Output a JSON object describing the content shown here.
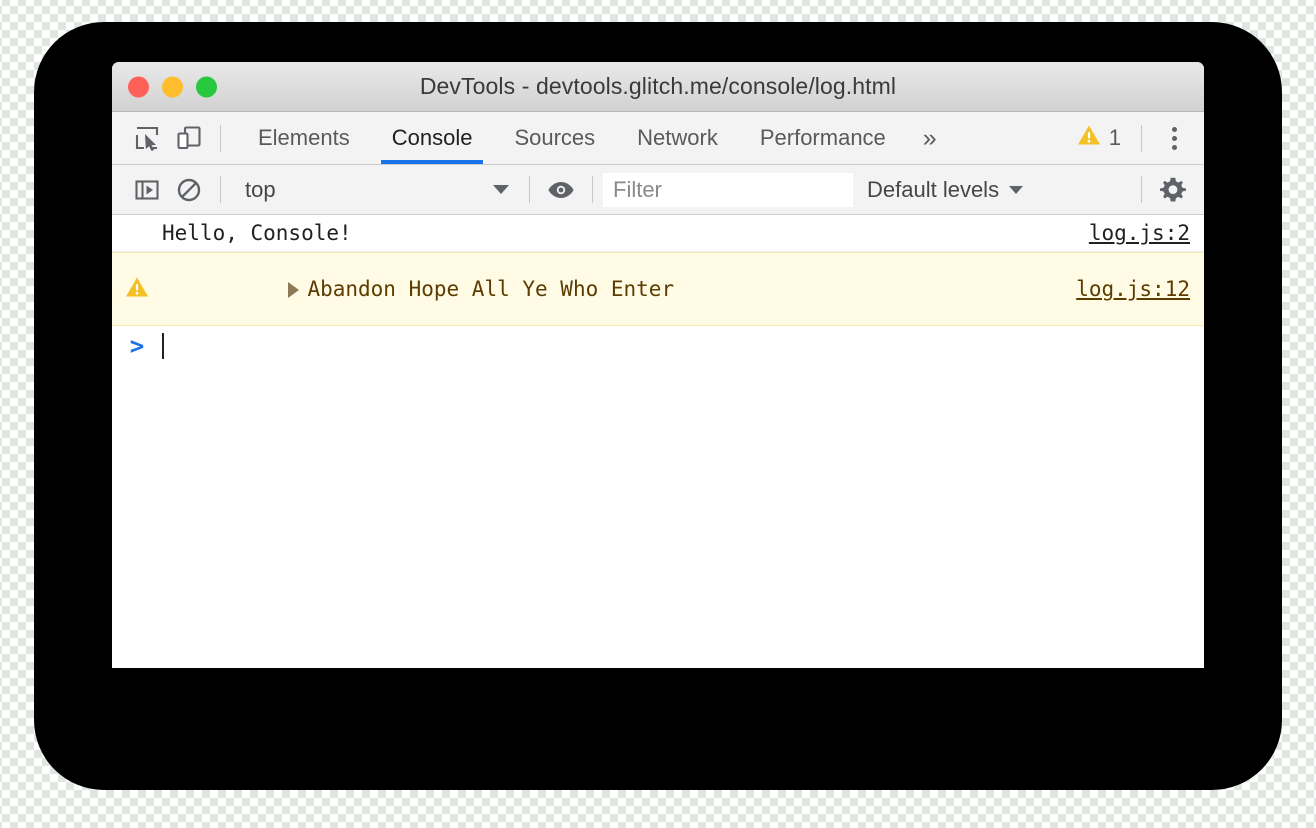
{
  "window": {
    "title": "DevTools - devtools.glitch.me/console/log.html",
    "traffic_lights": [
      {
        "name": "close",
        "color": "#ff6058"
      },
      {
        "name": "minimize",
        "color": "#ffbd2e"
      },
      {
        "name": "zoom",
        "color": "#28c83f"
      }
    ]
  },
  "tabbar": {
    "inspect_icon": "inspect-element-icon",
    "device_icon": "device-toolbar-icon",
    "tabs": [
      {
        "label": "Elements",
        "active": false
      },
      {
        "label": "Console",
        "active": true
      },
      {
        "label": "Sources",
        "active": false
      },
      {
        "label": "Network",
        "active": false
      },
      {
        "label": "Performance",
        "active": false
      }
    ],
    "more_tabs_label": "»",
    "warning_count": "1",
    "warning_icon": "warning-triangle-icon",
    "menu_icon": "kebab-menu-icon"
  },
  "console_toolbar": {
    "sidebar_icon": "console-sidebar-toggle-icon",
    "clear_icon": "clear-console-icon",
    "context_label": "top",
    "eye_icon": "live-expression-eye-icon",
    "filter_value": "",
    "filter_placeholder": "Filter",
    "levels_label": "Default levels",
    "settings_icon": "settings-gear-icon"
  },
  "console": {
    "messages": [
      {
        "level": "log",
        "text": "Hello, Console!",
        "source": "log.js:2",
        "has_disclosure": false,
        "has_icon": false
      },
      {
        "level": "warning",
        "text": "Abandon Hope All Ye Who Enter",
        "source": "log.js:12",
        "has_disclosure": true,
        "has_icon": true
      }
    ],
    "prompt_symbol": ">",
    "prompt_value": ""
  },
  "colors": {
    "accent_blue": "#1a73e8",
    "warning_amber": "#f5c026",
    "warning_bg": "#fffbe5",
    "warning_text": "#5c3c00",
    "toolbar_bg": "#f3f3f3",
    "backdrop": "#000000"
  }
}
